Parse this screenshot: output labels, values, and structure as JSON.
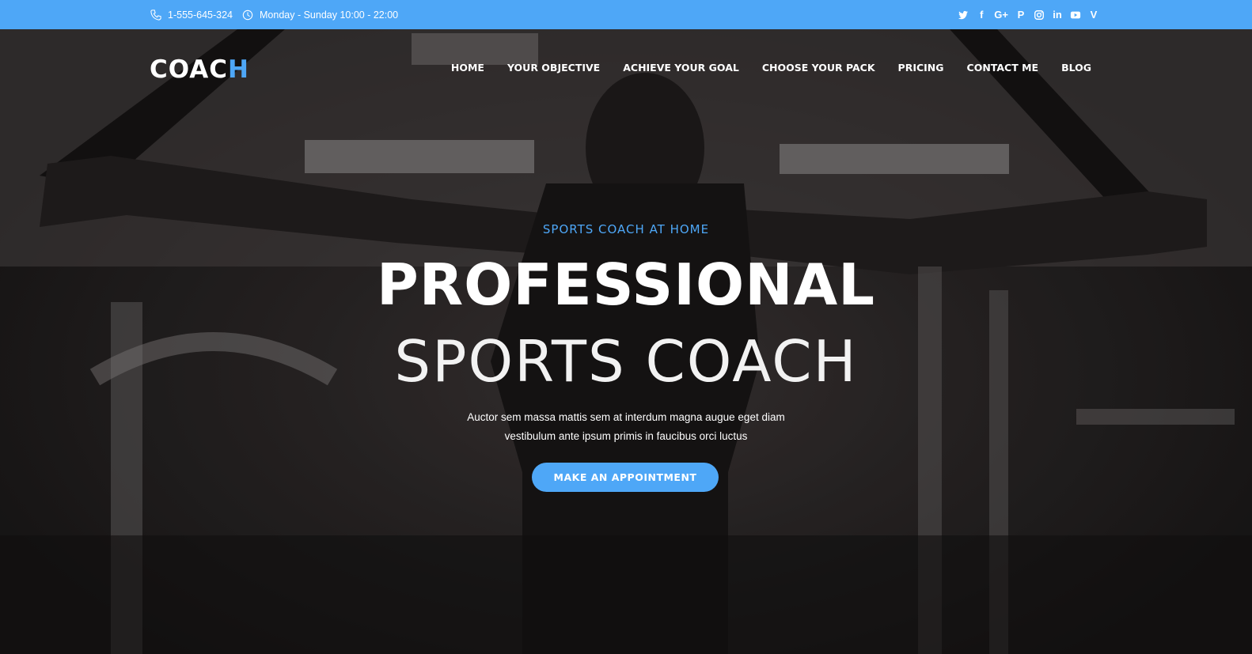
{
  "topbar": {
    "phone": "1-555-645-324",
    "hours": "Monday - Sunday 10:00 - 22:00",
    "socials": [
      "twitter-icon",
      "facebook-icon",
      "google-plus-icon",
      "pinterest-icon",
      "instagram-icon",
      "linkedin-icon",
      "youtube-icon",
      "vine-icon"
    ],
    "social_glyphs": {
      "twitter": "t",
      "facebook": "f",
      "google": "G+",
      "pinterest": "P",
      "instagram": "",
      "linkedin": "in",
      "youtube": "▶",
      "vine": "V"
    }
  },
  "header": {
    "logo_main": "COAC",
    "logo_accent": "H",
    "nav": [
      "HOME",
      "YOUR OBJECTIVE",
      "ACHIEVE YOUR GOAL",
      "CHOOSE YOUR PACK",
      "PRICING",
      "CONTACT ME",
      "BLOG"
    ]
  },
  "hero": {
    "eyebrow": "SPORTS COACH AT HOME",
    "title": "PROFESSIONAL",
    "subtitle": "SPORTS COACH",
    "description_line1": "Auctor sem massa mattis sem at interdum magna augue eget diam",
    "description_line2": "vestibulum ante ipsum primis in faucibus orci luctus",
    "cta": "MAKE AN APPOINTMENT"
  },
  "colors": {
    "accent": "#4ea7f7",
    "topbar": "#4ea7f7",
    "text": "#ffffff"
  }
}
